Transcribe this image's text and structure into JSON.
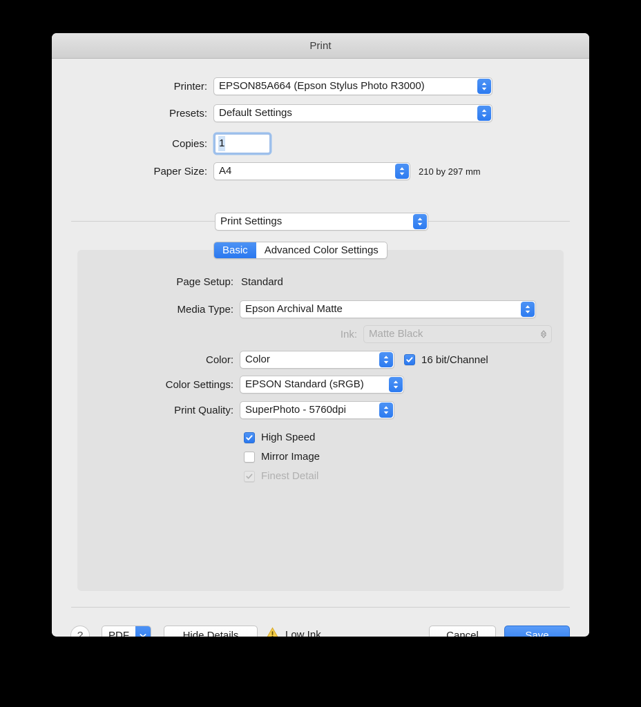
{
  "window": {
    "title": "Print"
  },
  "top_section": {
    "printer": {
      "label": "Printer:",
      "value": "EPSON85A664 (Epson Stylus Photo R3000)"
    },
    "presets": {
      "label": "Presets:",
      "value": "Default Settings"
    },
    "copies": {
      "label": "Copies:",
      "value": "1",
      "placeholder": "1"
    },
    "paper_size": {
      "label": "Paper Size:",
      "value": "A4",
      "dimensions": "210 by 297 mm"
    }
  },
  "pane_selector": {
    "value": "Print Settings"
  },
  "tabs": [
    {
      "label": "Basic",
      "active": true
    },
    {
      "label": "Advanced Color Settings",
      "active": false
    }
  ],
  "print_settings": {
    "page_setup": {
      "label": "Page Setup:",
      "value": "Standard"
    },
    "media_type": {
      "label": "Media Type:",
      "value": "Epson Archival Matte"
    },
    "ink": {
      "label": "Ink:",
      "value": "Matte Black",
      "disabled": true
    },
    "color": {
      "label": "Color:",
      "value": "Color"
    },
    "sixteen_bit": {
      "label": "16 bit/Channel",
      "checked": true
    },
    "color_settings": {
      "label": "Color Settings:",
      "value": "EPSON Standard (sRGB)"
    },
    "print_quality": {
      "label": "Print Quality:",
      "value": "SuperPhoto - 5760dpi"
    },
    "checkboxes": [
      {
        "label": "High Speed",
        "checked": true,
        "disabled": false
      },
      {
        "label": "Mirror Image",
        "checked": false,
        "disabled": false
      },
      {
        "label": "Finest Detail",
        "checked": true,
        "disabled": true
      }
    ]
  },
  "footer": {
    "help_label": "?",
    "pdf_label": "PDF",
    "hide_details_label": "Hide Details",
    "status_text": "Low Ink",
    "cancel_label": "Cancel",
    "save_label": "Save"
  },
  "colors": {
    "accent": "#2f7cf0",
    "window_bg": "#ececec",
    "panel_bg": "#e2e2e2",
    "warning": "#f0c419",
    "text": "#1d1d1d",
    "disabled_text": "#a9a9a9"
  }
}
